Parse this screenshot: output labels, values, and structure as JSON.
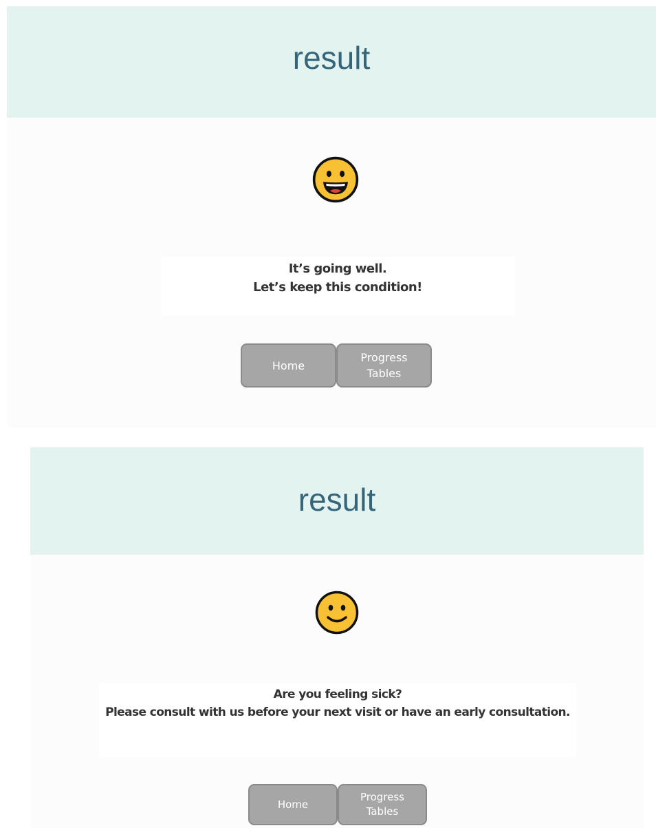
{
  "screens": [
    {
      "title": "result",
      "face": "grinning-face-icon",
      "message_line1": "It’s going well.",
      "message_line2": "Let’s keep this condition!",
      "home_label": "Home",
      "progress_label": "Progress Tables"
    },
    {
      "title": "result",
      "face": "slightly-smiling-face-icon",
      "message_line1": "Are you feeling sick?",
      "message_line2": "Please consult with us before your next visit or have an early consultation.",
      "home_label": "Home",
      "progress_label": "Progress Tables"
    }
  ],
  "colors": {
    "header_bg": "#e2f3f0",
    "title_text": "#35657a",
    "button_bg": "#a6a6a6",
    "face_yellow": "#f7c133"
  }
}
